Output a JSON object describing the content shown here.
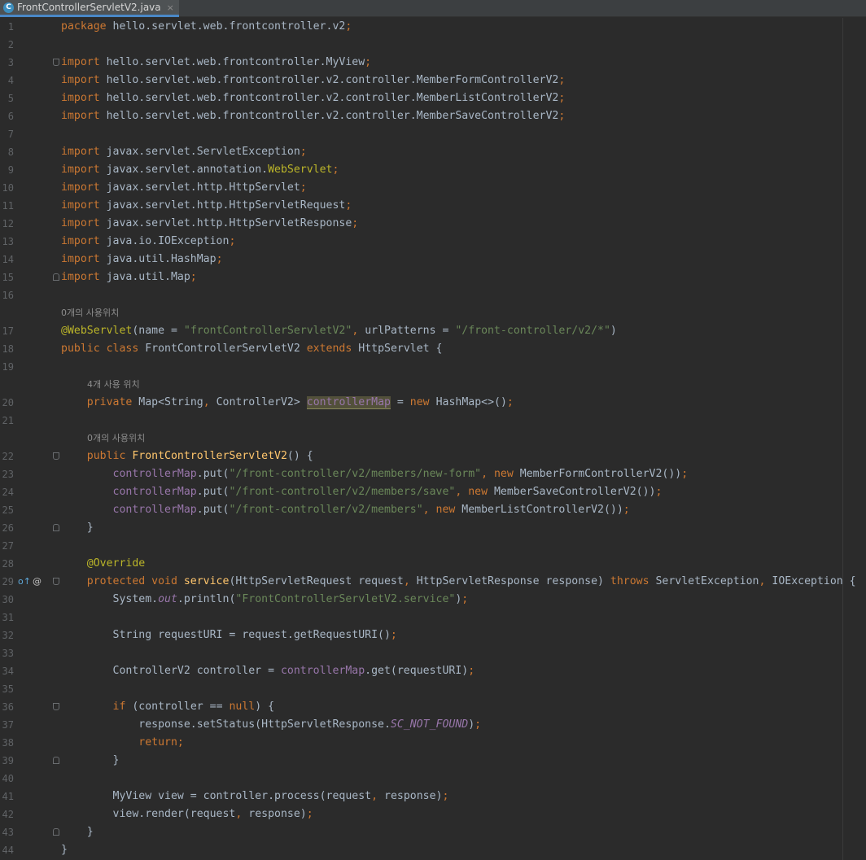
{
  "tab": {
    "icon_letter": "C",
    "title": "FrontControllerServletV2.java",
    "close": "×"
  },
  "gutter_icons": {
    "override_icon": "o↑",
    "at_icon": "@"
  },
  "lines": [
    {
      "n": "1",
      "tokens": [
        [
          "k",
          "package "
        ],
        [
          "",
          "hello.servlet.web.frontcontroller.v2"
        ],
        [
          "k",
          ";"
        ]
      ]
    },
    {
      "n": "2",
      "tokens": []
    },
    {
      "n": "3",
      "fold": "start",
      "tokens": [
        [
          "k",
          "import "
        ],
        [
          "",
          "hello.servlet.web.frontcontroller.MyView"
        ],
        [
          "k",
          ";"
        ]
      ]
    },
    {
      "n": "4",
      "tokens": [
        [
          "k",
          "import "
        ],
        [
          "",
          "hello.servlet.web.frontcontroller.v2.controller.MemberFormControllerV2"
        ],
        [
          "k",
          ";"
        ]
      ]
    },
    {
      "n": "5",
      "tokens": [
        [
          "k",
          "import "
        ],
        [
          "",
          "hello.servlet.web.frontcontroller.v2.controller.MemberListControllerV2"
        ],
        [
          "k",
          ";"
        ]
      ]
    },
    {
      "n": "6",
      "tokens": [
        [
          "k",
          "import "
        ],
        [
          "",
          "hello.servlet.web.frontcontroller.v2.controller.MemberSaveControllerV2"
        ],
        [
          "k",
          ";"
        ]
      ]
    },
    {
      "n": "7",
      "tokens": []
    },
    {
      "n": "8",
      "tokens": [
        [
          "k",
          "import "
        ],
        [
          "",
          "javax.servlet.ServletException"
        ],
        [
          "k",
          ";"
        ]
      ]
    },
    {
      "n": "9",
      "tokens": [
        [
          "k",
          "import "
        ],
        [
          "",
          "javax.servlet.annotation."
        ],
        [
          "a",
          "WebServlet"
        ],
        [
          "k",
          ";"
        ]
      ]
    },
    {
      "n": "10",
      "tokens": [
        [
          "k",
          "import "
        ],
        [
          "",
          "javax.servlet.http.HttpServlet"
        ],
        [
          "k",
          ";"
        ]
      ]
    },
    {
      "n": "11",
      "tokens": [
        [
          "k",
          "import "
        ],
        [
          "",
          "javax.servlet.http.HttpServletRequest"
        ],
        [
          "k",
          ";"
        ]
      ]
    },
    {
      "n": "12",
      "tokens": [
        [
          "k",
          "import "
        ],
        [
          "",
          "javax.servlet.http.HttpServletResponse"
        ],
        [
          "k",
          ";"
        ]
      ]
    },
    {
      "n": "13",
      "tokens": [
        [
          "k",
          "import "
        ],
        [
          "",
          "java.io.IOException"
        ],
        [
          "k",
          ";"
        ]
      ]
    },
    {
      "n": "14",
      "tokens": [
        [
          "k",
          "import "
        ],
        [
          "",
          "java.util.HashMap"
        ],
        [
          "k",
          ";"
        ]
      ]
    },
    {
      "n": "15",
      "fold": "end",
      "tokens": [
        [
          "k",
          "import "
        ],
        [
          "",
          "java.util.Map"
        ],
        [
          "k",
          ";"
        ]
      ]
    },
    {
      "n": "16",
      "tokens": []
    },
    {
      "hint": "0개의 사용위치",
      "indent": 0
    },
    {
      "n": "17",
      "tokens": [
        [
          "a",
          "@WebServlet"
        ],
        [
          "",
          "(name = "
        ],
        [
          "s",
          "\"frontControllerServletV2\""
        ],
        [
          "k",
          ", "
        ],
        [
          "",
          "urlPatterns = "
        ],
        [
          "s",
          "\"/front-controller/v2/*\""
        ],
        [
          "",
          ")"
        ]
      ]
    },
    {
      "n": "18",
      "tokens": [
        [
          "k",
          "public class "
        ],
        [
          "",
          "FrontControllerServletV2 "
        ],
        [
          "k",
          "extends "
        ],
        [
          "",
          "HttpServlet {"
        ]
      ]
    },
    {
      "n": "19",
      "tokens": []
    },
    {
      "hint": "4개 사용 위치",
      "indent": 1
    },
    {
      "n": "20",
      "tokens": [
        [
          "",
          "    "
        ],
        [
          "k",
          "private "
        ],
        [
          "",
          "Map<String"
        ],
        [
          "k",
          ", "
        ],
        [
          "",
          "ControllerV2> "
        ],
        [
          "fh",
          "controllerMap"
        ],
        [
          "",
          " = "
        ],
        [
          "k",
          "new "
        ],
        [
          "",
          "HashMap<>()"
        ],
        [
          "k",
          ";"
        ]
      ]
    },
    {
      "n": "21",
      "tokens": []
    },
    {
      "hint": "0개의 사용위치",
      "indent": 1
    },
    {
      "n": "22",
      "fold": "start",
      "tokens": [
        [
          "",
          "    "
        ],
        [
          "k",
          "public "
        ],
        [
          "m",
          "FrontControllerServletV2"
        ],
        [
          "",
          "() {"
        ]
      ]
    },
    {
      "n": "23",
      "tokens": [
        [
          "",
          "        "
        ],
        [
          "f",
          "controllerMap"
        ],
        [
          "",
          ".put("
        ],
        [
          "s",
          "\"/front-controller/v2/members/new-form\""
        ],
        [
          "k",
          ", new "
        ],
        [
          "",
          "MemberFormControllerV2())"
        ],
        [
          "k",
          ";"
        ]
      ]
    },
    {
      "n": "24",
      "tokens": [
        [
          "",
          "        "
        ],
        [
          "f",
          "controllerMap"
        ],
        [
          "",
          ".put("
        ],
        [
          "s",
          "\"/front-controller/v2/members/save\""
        ],
        [
          "k",
          ", new "
        ],
        [
          "",
          "MemberSaveControllerV2())"
        ],
        [
          "k",
          ";"
        ]
      ]
    },
    {
      "n": "25",
      "tokens": [
        [
          "",
          "        "
        ],
        [
          "f",
          "controllerMap"
        ],
        [
          "",
          ".put("
        ],
        [
          "s",
          "\"/front-controller/v2/members\""
        ],
        [
          "k",
          ", new "
        ],
        [
          "",
          "MemberListControllerV2())"
        ],
        [
          "k",
          ";"
        ]
      ]
    },
    {
      "n": "26",
      "fold": "end",
      "tokens": [
        [
          "",
          "    }"
        ]
      ]
    },
    {
      "n": "27",
      "tokens": []
    },
    {
      "n": "28",
      "tokens": [
        [
          "",
          "    "
        ],
        [
          "a",
          "@Override"
        ]
      ]
    },
    {
      "n": "29",
      "fold": "start",
      "icons": true,
      "tokens": [
        [
          "",
          "    "
        ],
        [
          "k",
          "protected void "
        ],
        [
          "m",
          "service"
        ],
        [
          "",
          "(HttpServletRequest request"
        ],
        [
          "k",
          ", "
        ],
        [
          "",
          "HttpServletResponse response) "
        ],
        [
          "k",
          "throws "
        ],
        [
          "",
          "ServletException"
        ],
        [
          "k",
          ", "
        ],
        [
          "",
          "IOException {"
        ]
      ]
    },
    {
      "n": "30",
      "tokens": [
        [
          "",
          "        System."
        ],
        [
          "fi",
          "out"
        ],
        [
          "",
          ".println("
        ],
        [
          "s",
          "\"FrontControllerServletV2.service\""
        ],
        [
          "",
          ")"
        ],
        [
          "k",
          ";"
        ]
      ]
    },
    {
      "n": "31",
      "tokens": []
    },
    {
      "n": "32",
      "tokens": [
        [
          "",
          "        String requestURI = request.getRequestURI()"
        ],
        [
          "k",
          ";"
        ]
      ]
    },
    {
      "n": "33",
      "tokens": []
    },
    {
      "n": "34",
      "tokens": [
        [
          "",
          "        ControllerV2 controller = "
        ],
        [
          "f",
          "controllerMap"
        ],
        [
          "",
          ".get(requestURI)"
        ],
        [
          "k",
          ";"
        ]
      ]
    },
    {
      "n": "35",
      "tokens": []
    },
    {
      "n": "36",
      "fold": "start",
      "tokens": [
        [
          "",
          "        "
        ],
        [
          "k",
          "if "
        ],
        [
          "",
          "(controller == "
        ],
        [
          "k",
          "null"
        ],
        [
          "",
          ") {"
        ]
      ]
    },
    {
      "n": "37",
      "tokens": [
        [
          "",
          "            response.setStatus(HttpServletResponse."
        ],
        [
          "fi",
          "SC_NOT_FOUND"
        ],
        [
          "",
          ")"
        ],
        [
          "k",
          ";"
        ]
      ]
    },
    {
      "n": "38",
      "tokens": [
        [
          "",
          "            "
        ],
        [
          "k",
          "return;"
        ]
      ]
    },
    {
      "n": "39",
      "fold": "end",
      "tokens": [
        [
          "",
          "        }"
        ]
      ]
    },
    {
      "n": "40",
      "tokens": []
    },
    {
      "n": "41",
      "tokens": [
        [
          "",
          "        MyView view = controller.process(request"
        ],
        [
          "k",
          ", "
        ],
        [
          "",
          "response)"
        ],
        [
          "k",
          ";"
        ]
      ]
    },
    {
      "n": "42",
      "tokens": [
        [
          "",
          "        view.render(request"
        ],
        [
          "k",
          ", "
        ],
        [
          "",
          "response)"
        ],
        [
          "k",
          ";"
        ]
      ]
    },
    {
      "n": "43",
      "fold": "end",
      "tokens": [
        [
          "",
          "    }"
        ]
      ]
    },
    {
      "n": "44",
      "tokens": [
        [
          "",
          "}"
        ]
      ]
    }
  ],
  "colors": {
    "background": "#2b2b2b",
    "keyword": "#cc7832",
    "string": "#6a8759",
    "field": "#9876aa",
    "annotation": "#bbb529",
    "method": "#ffc66d",
    "text": "#a9b7c6",
    "line_number": "#606366"
  }
}
